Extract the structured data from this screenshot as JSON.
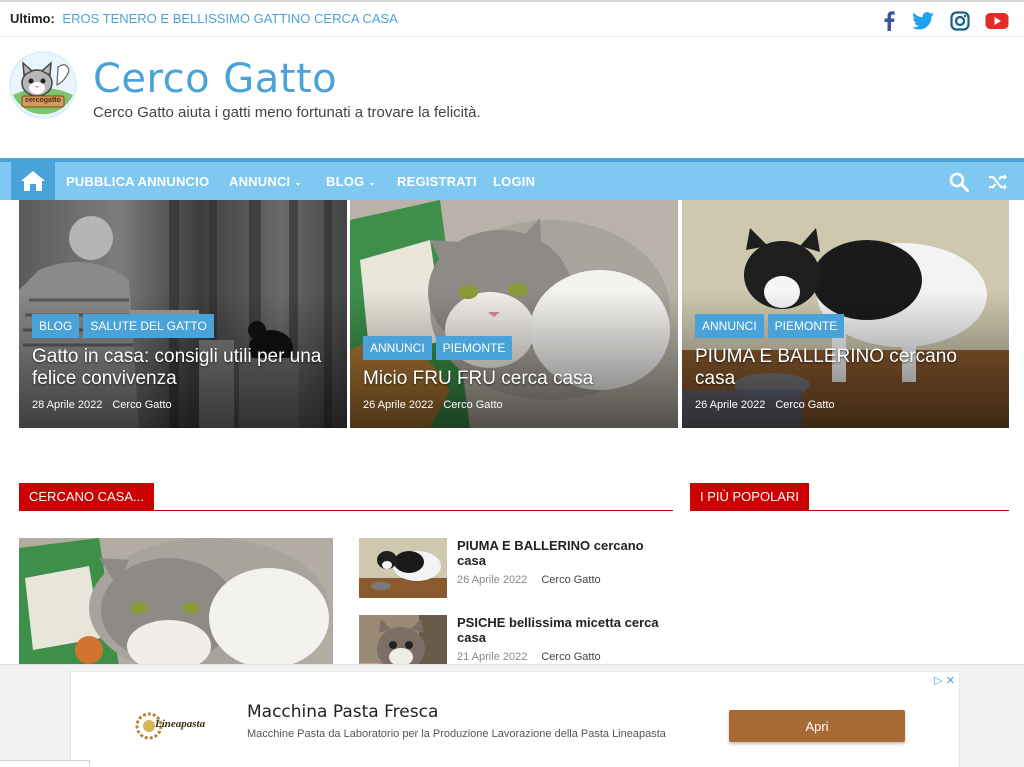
{
  "topbar": {
    "ticker_label": "Ultimo:",
    "ticker_link": "EROS TENERO E BELLISSIMO GATTINO CERCA CASA",
    "social": [
      "facebook-icon",
      "twitter-icon",
      "instagram-icon",
      "youtube-icon"
    ]
  },
  "header": {
    "title": "Cerco Gatto",
    "tagline": "Cerco Gatto aiuta i gatti meno fortunati a trovare la felicità.",
    "logo_text": "cercogatto"
  },
  "nav": {
    "items": [
      {
        "label": "PUBBLICA ANNUNCIO",
        "has_dropdown": false
      },
      {
        "label": "ANNUNCI",
        "has_dropdown": true
      },
      {
        "label": "BLOG",
        "has_dropdown": true
      },
      {
        "label": "REGISTRATI",
        "has_dropdown": false
      },
      {
        "label": "LOGIN",
        "has_dropdown": false
      }
    ],
    "chevron": "⌄"
  },
  "featured": [
    {
      "badges": [
        "BLOG",
        "SALUTE DEL GATTO"
      ],
      "title": "Gatto in casa: consigli utili per una felice convivenza",
      "date": "28 Aprile 2022",
      "author": "Cerco Gatto"
    },
    {
      "badges": [
        "ANNUNCI",
        "PIEMONTE"
      ],
      "title": "Micio FRU FRU cerca casa",
      "date": "26 Aprile 2022",
      "author": "Cerco Gatto"
    },
    {
      "badges": [
        "ANNUNCI",
        "PIEMONTE"
      ],
      "title": "PIUMA E BALLERINO cercano casa",
      "date": "26 Aprile 2022",
      "author": "Cerco Gatto"
    }
  ],
  "sections": {
    "left": "CERCANO CASA...",
    "right": "I PIÙ POPOLARI"
  },
  "posts": [
    {
      "title": "PIUMA E BALLERINO cercano casa",
      "date": "26 Aprile 2022",
      "author": "Cerco Gatto"
    },
    {
      "title": "PSICHE bellissima micetta cerca casa",
      "date": "21 Aprile 2022",
      "author": "Cerco Gatto"
    }
  ],
  "ad": {
    "logo_text": "Lineapasta",
    "title": "Macchina Pasta Fresca",
    "description": "Macchine Pasta da Laboratorio per la Produzione Lavorazione della Pasta Lineapasta",
    "button": "Apri",
    "badge": "▷ ✕"
  },
  "colors": {
    "accent": "#4aa3d8",
    "nav_bg": "#7ec8f1",
    "section_red": "#cc0000",
    "ad_button": "#a86a35"
  }
}
